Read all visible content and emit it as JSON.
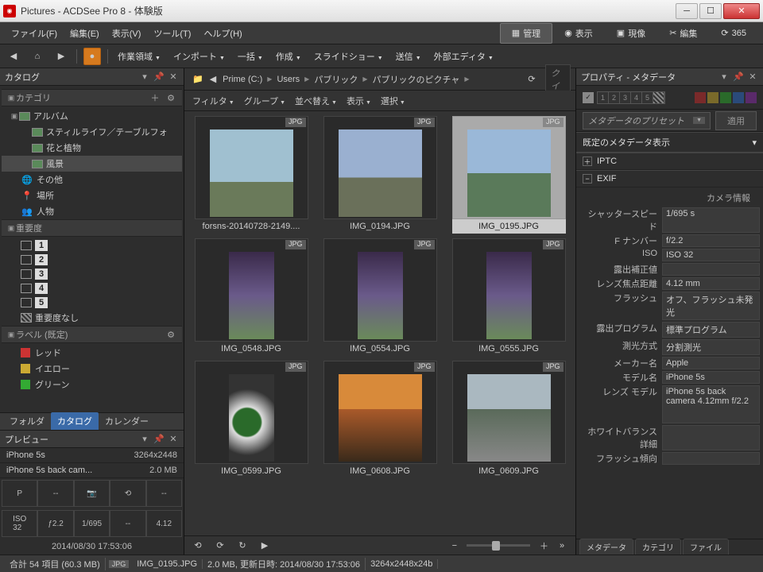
{
  "titlebar": {
    "title": "Pictures - ACDSee Pro 8 - 体験版"
  },
  "menubar": {
    "file": "ファイル(F)",
    "edit": "編集(E)",
    "view": "表示(V)",
    "tool": "ツール(T)",
    "help": "ヘルプ(H)",
    "manage": "管理",
    "display": "表示",
    "develop": "現像",
    "editmode": "編集",
    "cloud": "365"
  },
  "toolbar": {
    "workspace": "作業領域",
    "import": "インポート",
    "batch": "一括",
    "create": "作成",
    "slideshow": "スライドショー",
    "send": "送信",
    "extedit": "外部エディタ"
  },
  "catalog": {
    "title": "カタログ",
    "sect_category": "カテゴリ",
    "album": "アルバム",
    "items": {
      "still": "スティルライフ／テーブルフォ",
      "flower": "花と植物",
      "landscape": "風景"
    },
    "other": "その他",
    "place": "場所",
    "people": "人物",
    "sect_importance": "重要度",
    "r1": "1",
    "r2": "2",
    "r3": "3",
    "r4": "4",
    "r5": "5",
    "rnone": "重要度なし",
    "sect_label": "ラベル (既定)",
    "red": "レッド",
    "yellow": "イエロー",
    "green": "グリーン",
    "tabs": {
      "folder": "フォルダ",
      "catalog": "カタログ",
      "calendar": "カレンダー"
    }
  },
  "preview": {
    "title": "プレビュー",
    "model": "iPhone 5s",
    "res": "3264x2448",
    "camera": "iPhone 5s back cam...",
    "size": "2.0 MB",
    "p": "P",
    "iso_l": "ISO\n32",
    "fnum": "ƒ2.2",
    "shut": "1/695",
    "dash": "--",
    "focal": "4.12",
    "date": "2014/08/30 17:53:06"
  },
  "breadcrumb": {
    "drive": "Prime (C:)",
    "s1": "Users",
    "s2": "パブリック",
    "s3": "パブリックのピクチャ",
    "search_ph": "クイ"
  },
  "filterbar": {
    "filter": "フィルタ",
    "group": "グループ",
    "sort": "並べ替え",
    "view": "表示",
    "select": "選択"
  },
  "thumbs": [
    {
      "name": "forsns-20140728-2149....",
      "fmt": "JPG",
      "cls": "sky1"
    },
    {
      "name": "IMG_0194.JPG",
      "fmt": "JPG",
      "cls": "sky2"
    },
    {
      "name": "IMG_0195.JPG",
      "fmt": "JPG",
      "cls": "sky3",
      "sel": true
    },
    {
      "name": "IMG_0548.JPG",
      "fmt": "JPG",
      "cls": "wist",
      "tall": true
    },
    {
      "name": "IMG_0554.JPG",
      "fmt": "JPG",
      "cls": "wist",
      "tall": true
    },
    {
      "name": "IMG_0555.JPG",
      "fmt": "JPG",
      "cls": "wist",
      "tall": true
    },
    {
      "name": "IMG_0599.JPG",
      "fmt": "JPG",
      "cls": "tea",
      "tall": true
    },
    {
      "name": "IMG_0608.JPG",
      "fmt": "JPG",
      "cls": "sunset"
    },
    {
      "name": "IMG_0609.JPG",
      "fmt": "JPG",
      "cls": "river"
    }
  ],
  "properties": {
    "title": "プロパティ - メタデータ",
    "preset_ph": "メタデータのプリセット",
    "apply": "適用",
    "default_meta": "既定のメタデータ表示",
    "iptc": "IPTC",
    "exif": "EXIF",
    "camera_info": "カメラ情報",
    "rows": {
      "shutter_l": "シャッタースピード",
      "shutter_v": "1/695 s",
      "fnum_l": "F ナンバー",
      "fnum_v": "f/2.2",
      "iso_l": "ISO",
      "iso_v": "ISO 32",
      "evcomp_l": "露出補正値",
      "evcomp_v": "",
      "focal_l": "レンズ焦点距離",
      "focal_v": "4.12 mm",
      "flash_l": "フラッシュ",
      "flash_v": "オフ、フラッシュ未発光",
      "prog_l": "露出プログラム",
      "prog_v": "標準プログラム",
      "meter_l": "測光方式",
      "meter_v": "分割測光",
      "maker_l": "メーカー名",
      "maker_v": "Apple",
      "model_l": "モデル名",
      "model_v": "iPhone 5s",
      "lens_l": "レンズ モデル",
      "lens_v": "iPhone 5s back camera 4.12mm f/2.2",
      "wb_l": "ホワイトバランス詳細",
      "wb_v": "",
      "flashb_l": "フラッシュ傾向",
      "flashb_v": ""
    },
    "tabs": {
      "meta": "メタデータ",
      "cat": "カテゴリ",
      "file": "ファイル"
    }
  },
  "statusbar": {
    "total": "合計 54 項目 (60.3 MB)",
    "fmt": "JPG",
    "fname": "IMG_0195.JPG",
    "detail": "2.0 MB, 更新日時: 2014/08/30 17:53:06",
    "dim": "3264x2448x24b"
  }
}
